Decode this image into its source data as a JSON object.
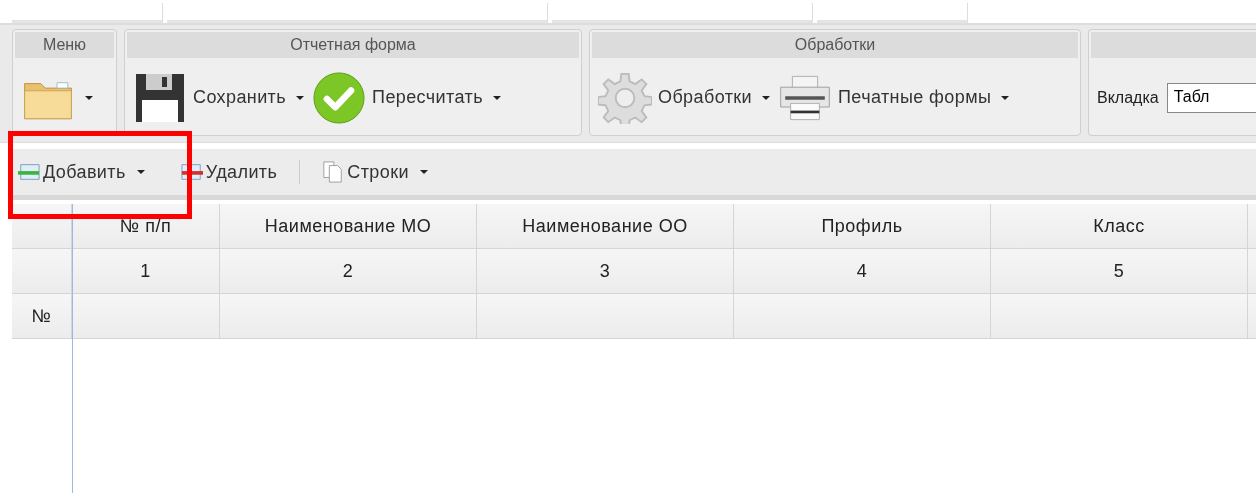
{
  "ribbon": {
    "groups": [
      {
        "title": "Меню",
        "items": [
          {
            "kind": "folder",
            "dropdown": true
          }
        ]
      },
      {
        "title": "Отчетная форма",
        "items": [
          {
            "kind": "save",
            "label": "Сохранить",
            "dropdown": true
          },
          {
            "kind": "check",
            "label": "Пересчитать",
            "dropdown": true
          }
        ]
      },
      {
        "title": "Обработки",
        "items": [
          {
            "kind": "gear",
            "label": "Обработки",
            "dropdown": true
          },
          {
            "kind": "printer",
            "label": "Печатные формы",
            "dropdown": true
          }
        ]
      },
      {
        "items": [
          {
            "kind": "field",
            "label": "Вкладка",
            "value": "Табл"
          }
        ]
      }
    ]
  },
  "toolbar": [
    {
      "kind": "add",
      "label": "Добавить",
      "dropdown": true
    },
    {
      "kind": "delete",
      "label": "Удалить",
      "dropdown": false
    },
    {
      "kind": "separator"
    },
    {
      "kind": "rows",
      "label": "Строки",
      "dropdown": true
    }
  ],
  "grid": {
    "columns": [
      "№ п/п",
      "Наименование МО",
      "Наименование ОО",
      "Профиль",
      "Класс"
    ],
    "column_numbers": [
      "1",
      "2",
      "3",
      "4",
      "5"
    ],
    "row_header": "№"
  },
  "highlight": {
    "shown": true
  }
}
